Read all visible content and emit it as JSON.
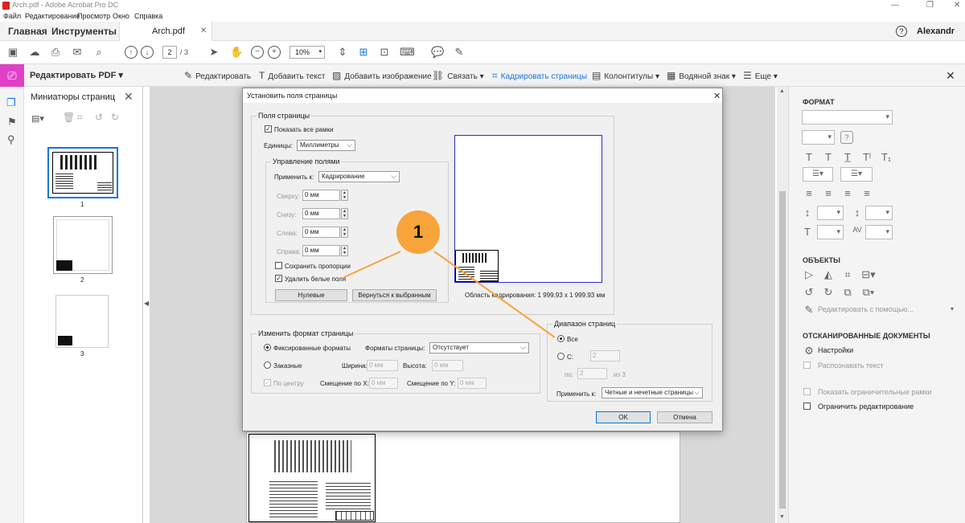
{
  "window": {
    "title": "Arch.pdf - Adobe Acrobat Pro DC"
  },
  "menu": [
    "Файл",
    "Редактирование",
    "Просмотр",
    "Окно",
    "Справка"
  ],
  "nav": {
    "home": "Главная",
    "tools": "Инструменты",
    "doc_tab": "Arch.pdf",
    "user": "Alexandr"
  },
  "toolbar": {
    "page_current": "2",
    "page_total": "/ 3",
    "zoom": "10%"
  },
  "editbar": {
    "title": "Редактировать PDF",
    "items": [
      "Редактировать",
      "Добавить текст",
      "Добавить изображение",
      "Связать",
      "Кадрировать страницы",
      "Колонтитулы",
      "Водяной знак",
      "Еще"
    ]
  },
  "thumbs": {
    "title": "Миниатюры страниц",
    "pages": [
      "1",
      "2",
      "3"
    ]
  },
  "right": {
    "format_h": "ФОРМАТ",
    "objects_h": "ОБЪЕКТЫ",
    "edit_with": "Редактировать с помощью...",
    "scanned_h": "ОТСКАНИРОВАННЫЕ ДОКУМЕНТЫ",
    "settings": "Настройки",
    "recognize": "Распознавать текст",
    "show_bounds": "Показать ограничительные рамки",
    "restrict": "Ограничить редактирование"
  },
  "dialog": {
    "title": "Установить поля страницы",
    "margins_group": "Поля страницы",
    "show_all": "Показать все рамки",
    "units_label": "Единицы:",
    "units_value": "Миллиметры",
    "control_group": "Управление полями",
    "apply_to_label": "Применить к:",
    "apply_to_value": "Кадрирование",
    "top_label": "Сверху:",
    "bottom_label": "Снизу:",
    "left_label": "Слева:",
    "right_label": "Справа:",
    "top": "0 мм",
    "bottom": "0 мм",
    "left": "0 мм",
    "right": "0 мм",
    "keep_prop": "Сохранить пропорции",
    "remove_white": "Удалить белые поля",
    "zero_btn": "Нулевые",
    "revert_btn": "Вернуться к выбранным",
    "crop_area": "Область кадрирования: 1 999.93 x 1 999.93 мм",
    "resize_group": "Изменить формат страницы",
    "fixed": "Фиксированные форматы",
    "page_sizes_label": "Форматы страницы:",
    "page_sizes_value": "Отсутствует",
    "custom": "Заказные",
    "width_label": "Ширина:",
    "width": "0 мм",
    "height_label": "Высота:",
    "height": "0 мм",
    "center": "По центру",
    "xoff_label": "Смещение по X:",
    "xoff": "0 мм",
    "yoff_label": "Смещение по Y:",
    "yoff": "0 мм",
    "range_group": "Диапазон страниц",
    "all": "Все",
    "from_label": "С:",
    "from": "2",
    "to_label": "по:",
    "to": "2",
    "of": "из 3",
    "apply_label": "Применить к:",
    "apply_value": "Четные и нечетные страницы",
    "ok": "OK",
    "cancel": "Отмена"
  },
  "callout": {
    "number": "1"
  },
  "colors": {
    "accent": "#1473e6",
    "callout": "#f7a43a",
    "dialog_bg": "#f0f0f0"
  }
}
